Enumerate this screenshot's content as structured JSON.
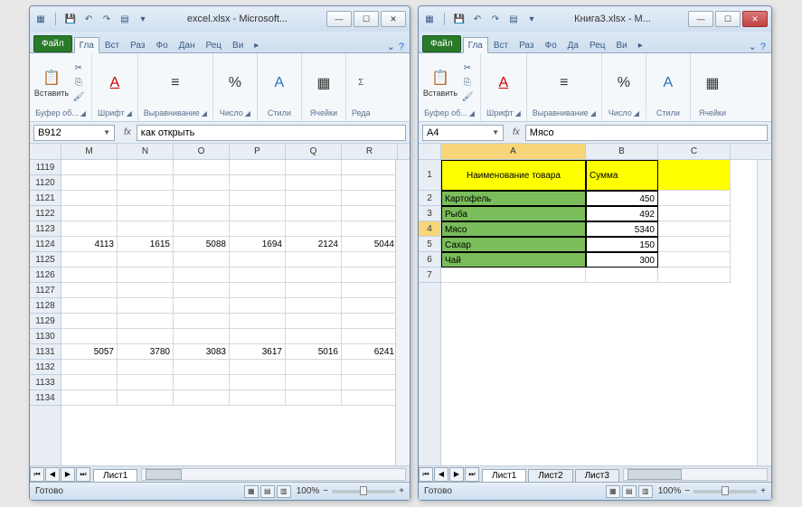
{
  "left": {
    "qat_file": "excel.xlsx",
    "title": "excel.xlsx - Microsoft...",
    "tabs": {
      "file": "Файл",
      "home": "Гла",
      "insert": "Вст",
      "layout": "Раз",
      "formulas": "Фо",
      "data": "Дан",
      "review": "Рец",
      "view": "Ви"
    },
    "groups": {
      "clipboard": "Буфер об...",
      "paste": "Вставить",
      "font": "Шрифт",
      "align": "Выравнивание",
      "number": "Число",
      "styles": "Стили",
      "cells": "Ячейки",
      "edit": "Реда"
    },
    "name_box": "B912",
    "formula": "как открыть",
    "fx": "fx",
    "col_headers": [
      "M",
      "N",
      "O",
      "P",
      "Q",
      "R"
    ],
    "row_headers": [
      "1119",
      "1120",
      "1121",
      "1122",
      "1123",
      "1124",
      "1125",
      "1126",
      "1127",
      "1128",
      "1129",
      "1130",
      "1131",
      "1132",
      "1133",
      "1134"
    ],
    "data_1124": [
      "4113",
      "1615",
      "5088",
      "1694",
      "2124",
      "5044"
    ],
    "data_1131": [
      "5057",
      "3780",
      "3083",
      "3617",
      "5016",
      "6241"
    ],
    "sheet1": "Лист1",
    "status": "Готово",
    "zoom": "100%"
  },
  "right": {
    "title": "Книга3.xlsx - M...",
    "tabs": {
      "file": "Файл",
      "home": "Гла",
      "insert": "Вст",
      "layout": "Раз",
      "formulas": "Фо",
      "data": "Да",
      "review": "Рец",
      "view": "Ви"
    },
    "groups": {
      "clipboard": "Буфер об...",
      "paste": "Вставить",
      "font": "Шрифт",
      "align": "Выравнивание",
      "number": "Число",
      "styles": "Стили",
      "cells": "Ячейки"
    },
    "name_box": "A4",
    "formula": "Мясо",
    "fx": "fx",
    "col_headers": [
      "A",
      "B",
      "C"
    ],
    "row_headers": [
      "1",
      "2",
      "3",
      "4",
      "5",
      "6",
      "7"
    ],
    "header_a": "Наименование товара",
    "header_b": "Сумма",
    "rows": [
      {
        "a": "Картофель",
        "b": "450"
      },
      {
        "a": "Рыба",
        "b": "492"
      },
      {
        "a": "Мясо",
        "b": "5340"
      },
      {
        "a": "Сахар",
        "b": "150"
      },
      {
        "a": "Чай",
        "b": "300"
      }
    ],
    "sheets": [
      "Лист1",
      "Лист2",
      "Лист3"
    ],
    "status": "Готово",
    "zoom": "100%"
  }
}
